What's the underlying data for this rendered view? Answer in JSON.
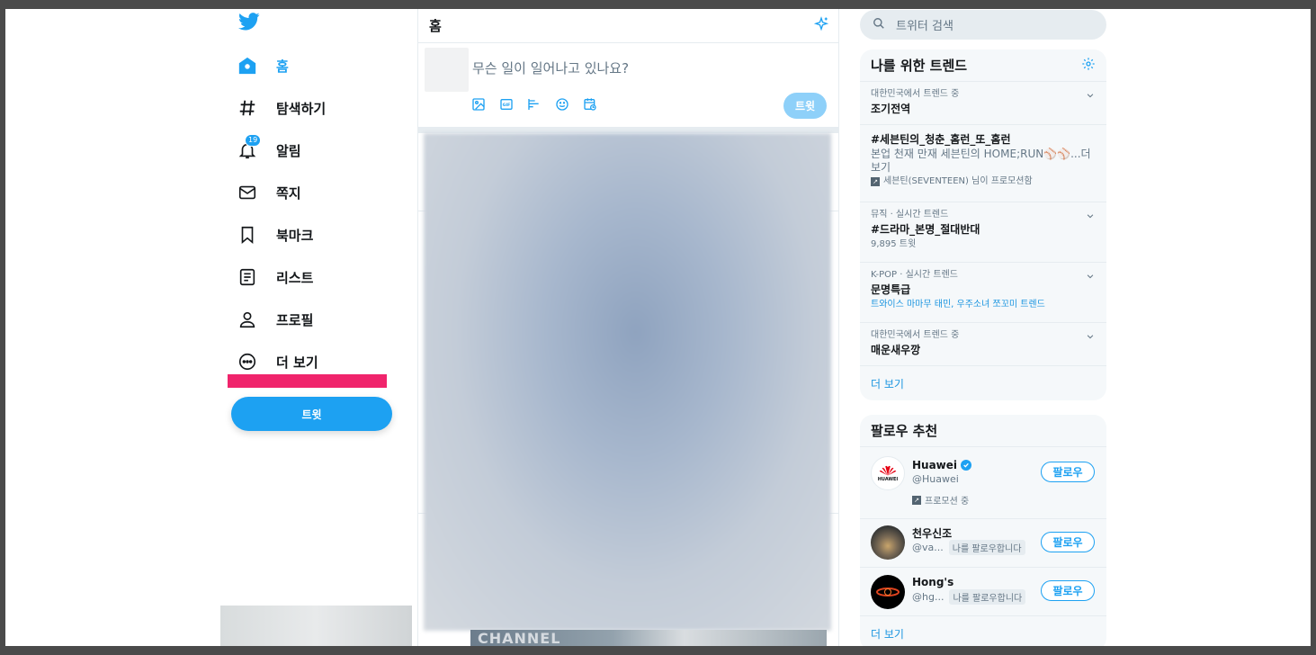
{
  "colors": {
    "accent": "#1da1f2",
    "highlight_bar": "#f0246c",
    "text_secondary": "#657786"
  },
  "sidebar": {
    "logo": "twitter-bird-icon",
    "items": [
      {
        "label": "홈",
        "icon": "home-icon",
        "active": true
      },
      {
        "label": "탐색하기",
        "icon": "hashtag-icon"
      },
      {
        "label": "알림",
        "icon": "bell-icon",
        "badge": "19"
      },
      {
        "label": "쪽지",
        "icon": "envelope-icon"
      },
      {
        "label": "북마크",
        "icon": "bookmark-icon"
      },
      {
        "label": "리스트",
        "icon": "list-icon"
      },
      {
        "label": "프로필",
        "icon": "profile-icon"
      },
      {
        "label": "더 보기",
        "icon": "more-circle-icon"
      }
    ],
    "tweet_button": "트윗"
  },
  "center": {
    "title": "홈",
    "compose": {
      "placeholder": "무슨 일이 일어나고 있나요?",
      "tools": [
        "image-icon",
        "gif-icon",
        "poll-icon",
        "emoji-icon",
        "schedule-icon"
      ],
      "send_label": "트윗"
    },
    "feed_bottom_text": "CHANNEL"
  },
  "right": {
    "search": {
      "placeholder": "트위터 검색"
    },
    "trends": {
      "title": "나를 위한 트렌드",
      "items": [
        {
          "meta": "대한민국에서 트렌드 중",
          "name": "조기전역"
        },
        {
          "meta": "",
          "name": "#세븐틴의_청춘_홈런_또_홈런",
          "desc": "본업 천재 만재 세븐틴의 HOME;RUN⚾⚾...더보기",
          "promo": "세븐틴(SEVENTEEN) 님이 프로모션함"
        },
        {
          "meta": "뮤직 · 실시간 트렌드",
          "name": "#드라마_본명_절대반대",
          "count": "9,895 트윗"
        },
        {
          "meta": "K-POP · 실시간 트렌드",
          "name": "문명특급",
          "desc_blue": "트와이스 마마무 태민, 우주소녀 쪼꼬미 트렌드"
        },
        {
          "meta": "대한민국에서 트렌드 중",
          "name": "매운새우깡"
        }
      ],
      "more": "더 보기"
    },
    "follow": {
      "title": "팔로우 추천",
      "items": [
        {
          "name": "Huawei",
          "handle": "@Huawei",
          "promo": "프로모션 중",
          "verified": true,
          "button": "팔로우",
          "avatar_text": "HUAWEI"
        },
        {
          "name": "천우신조",
          "handle": "@va...",
          "follows_you": "나를 팔로우합니다",
          "button": "팔로우"
        },
        {
          "name": "Hong's",
          "handle": "@hg...",
          "follows_you": "나를 팔로우합니다",
          "button": "팔로우"
        }
      ],
      "more": "더 보기"
    }
  }
}
